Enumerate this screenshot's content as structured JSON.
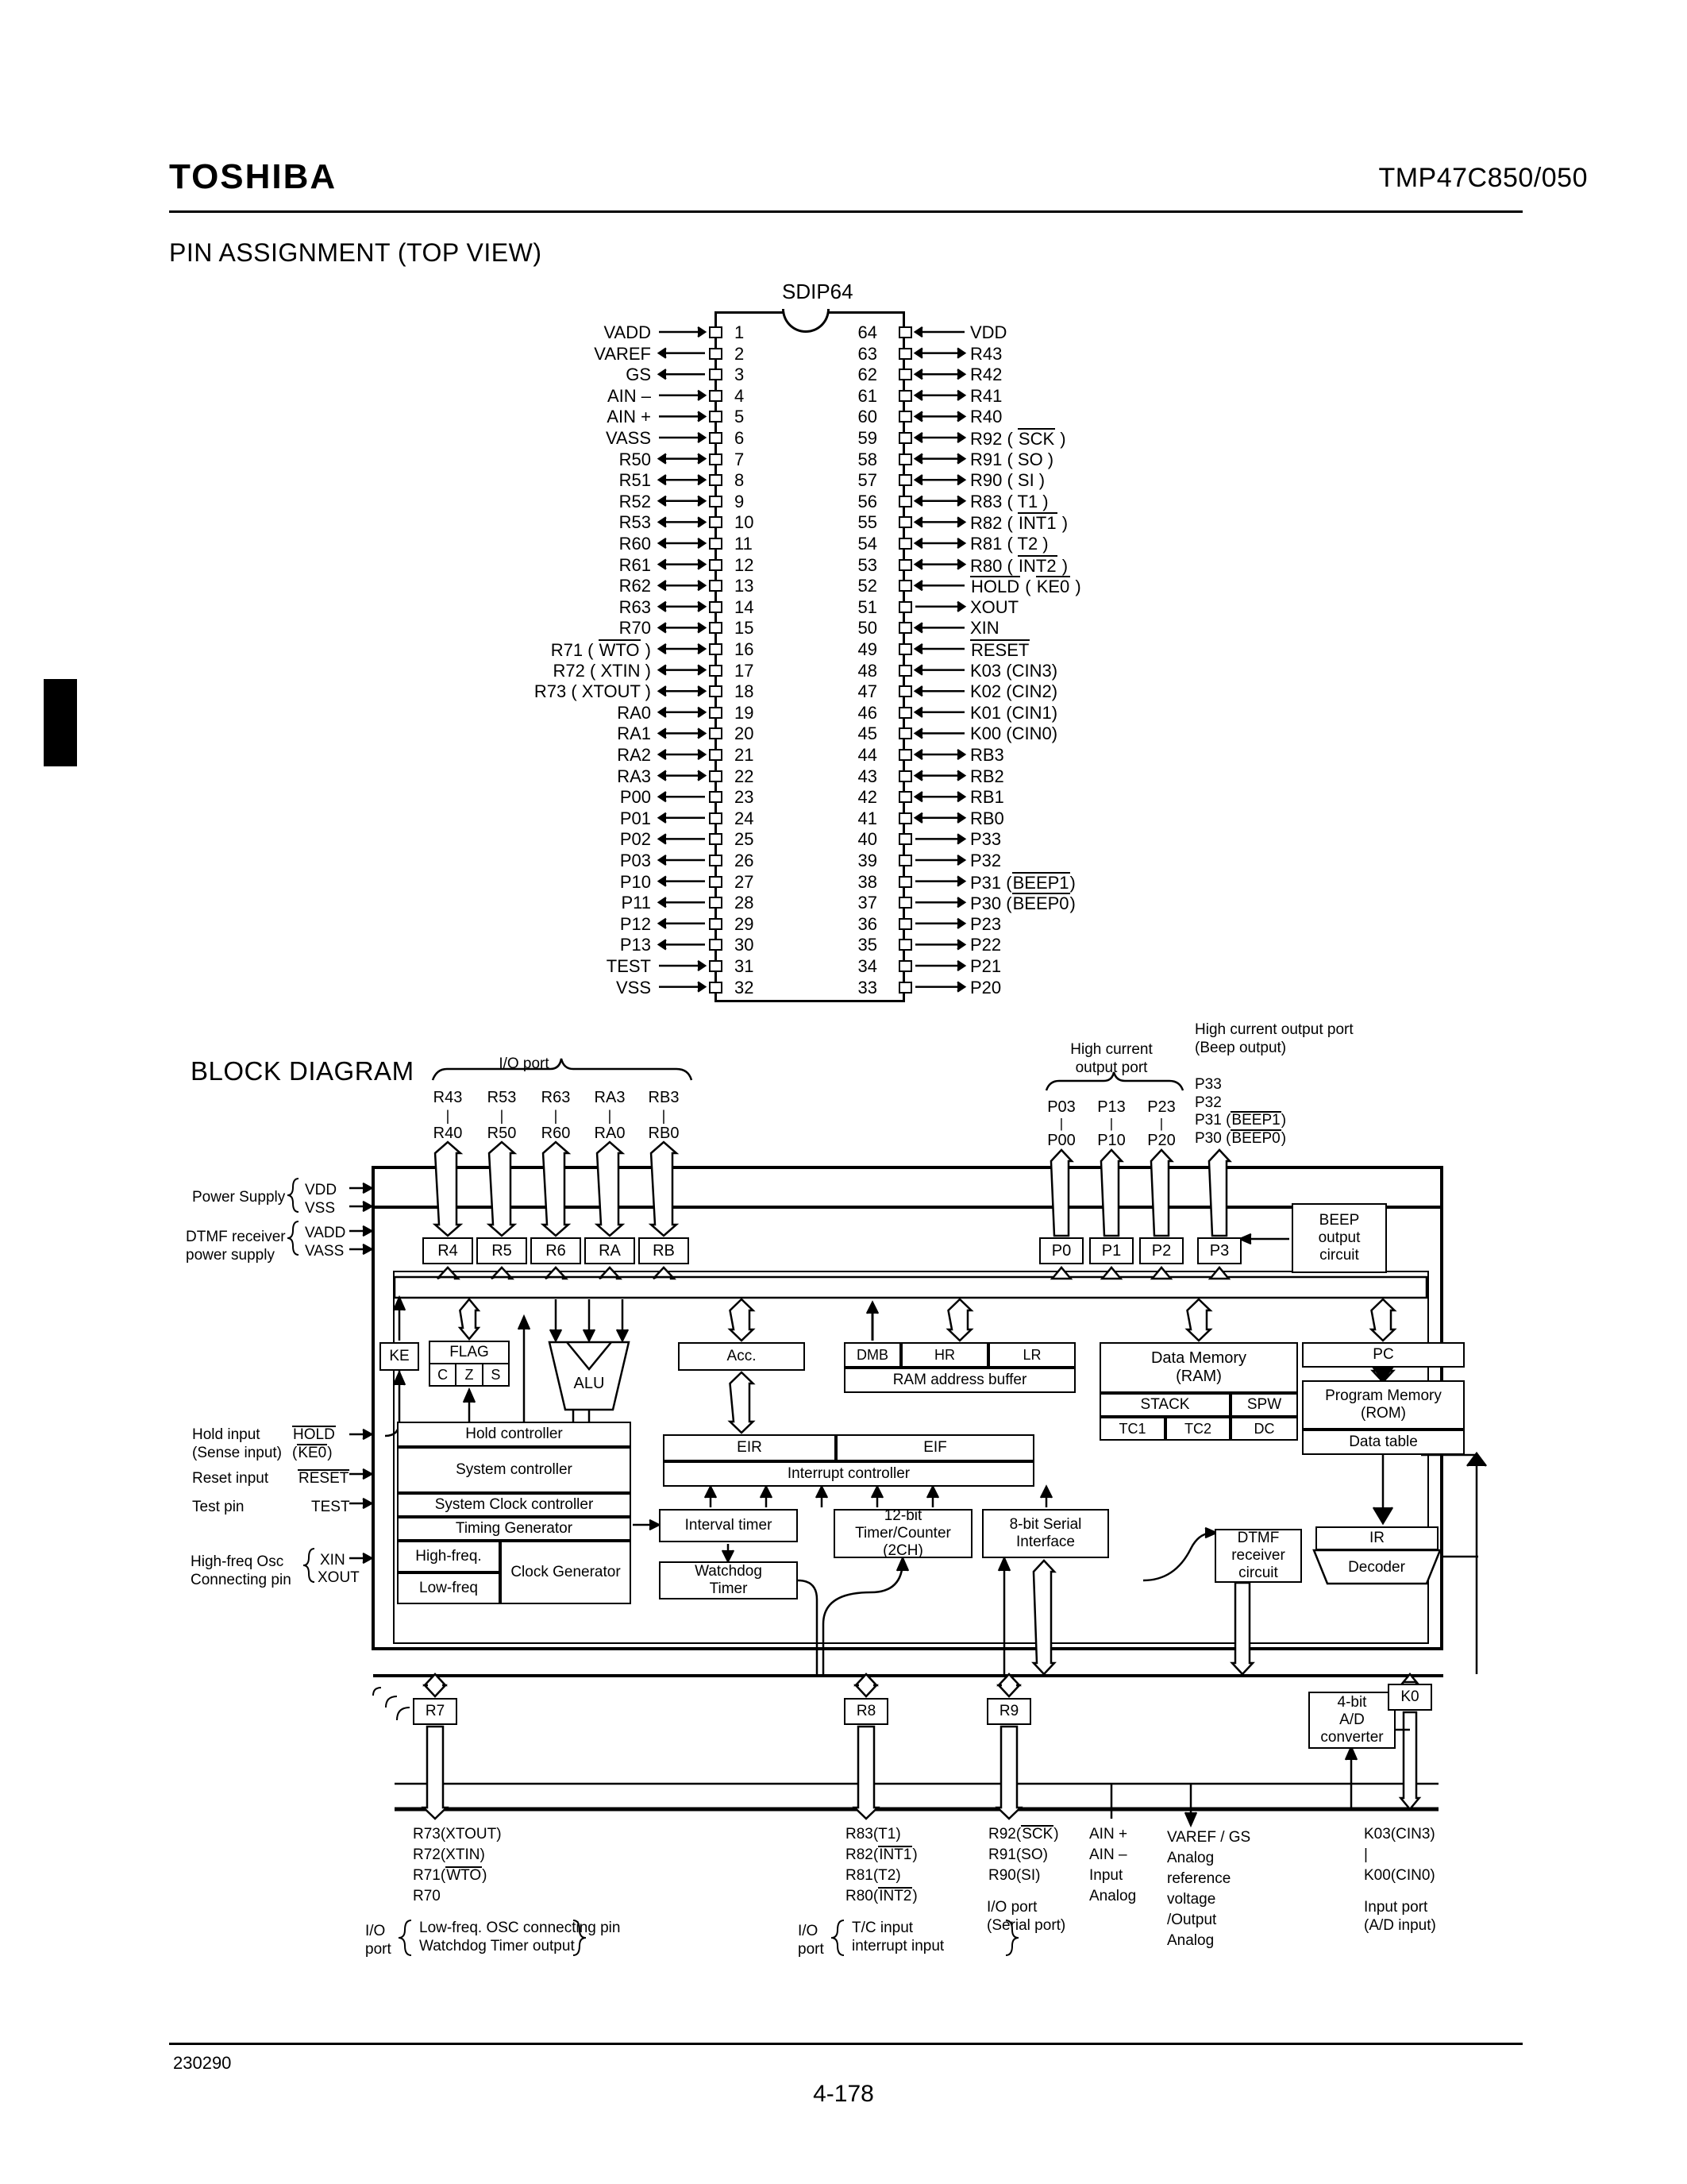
{
  "header": {
    "brand": "TOSHIBA",
    "part_number": "TMP47C850/050"
  },
  "pin_assignment": {
    "section_title": "PIN ASSIGNMENT (TOP VIEW)",
    "package": "SDIP64",
    "left_pins": [
      {
        "num": "1",
        "label": "VADD",
        "dir": "in"
      },
      {
        "num": "2",
        "label": "VAREF",
        "dir": "out"
      },
      {
        "num": "3",
        "label": "GS",
        "dir": "out"
      },
      {
        "num": "4",
        "label": "AIN –",
        "dir": "in"
      },
      {
        "num": "5",
        "label": "AIN +",
        "dir": "in"
      },
      {
        "num": "6",
        "label": "VASS",
        "dir": "in"
      },
      {
        "num": "7",
        "label": "R50",
        "dir": "io"
      },
      {
        "num": "8",
        "label": "R51",
        "dir": "io"
      },
      {
        "num": "9",
        "label": "R52",
        "dir": "io"
      },
      {
        "num": "10",
        "label": "R53",
        "dir": "io"
      },
      {
        "num": "11",
        "label": "R60",
        "dir": "io"
      },
      {
        "num": "12",
        "label": "R61",
        "dir": "io"
      },
      {
        "num": "13",
        "label": "R62",
        "dir": "io"
      },
      {
        "num": "14",
        "label": "R63",
        "dir": "io"
      },
      {
        "num": "15",
        "label": "R70",
        "dir": "io"
      },
      {
        "num": "16",
        "label": "R71 ( WTO )",
        "dir": "io",
        "overline": "WTO"
      },
      {
        "num": "17",
        "label": "R72 ( XTIN )",
        "dir": "io"
      },
      {
        "num": "18",
        "label": "R73 ( XTOUT )",
        "dir": "io"
      },
      {
        "num": "19",
        "label": "RA0",
        "dir": "io"
      },
      {
        "num": "20",
        "label": "RA1",
        "dir": "io"
      },
      {
        "num": "21",
        "label": "RA2",
        "dir": "io"
      },
      {
        "num": "22",
        "label": "RA3",
        "dir": "io"
      },
      {
        "num": "23",
        "label": "P00",
        "dir": "out"
      },
      {
        "num": "24",
        "label": "P01",
        "dir": "out"
      },
      {
        "num": "25",
        "label": "P02",
        "dir": "out"
      },
      {
        "num": "26",
        "label": "P03",
        "dir": "out"
      },
      {
        "num": "27",
        "label": "P10",
        "dir": "out"
      },
      {
        "num": "28",
        "label": "P11",
        "dir": "out"
      },
      {
        "num": "29",
        "label": "P12",
        "dir": "out"
      },
      {
        "num": "30",
        "label": "P13",
        "dir": "out"
      },
      {
        "num": "31",
        "label": "TEST",
        "dir": "in"
      },
      {
        "num": "32",
        "label": "VSS",
        "dir": "in"
      }
    ],
    "right_pins": [
      {
        "num": "64",
        "label": "VDD",
        "dir": "in"
      },
      {
        "num": "63",
        "label": "R43",
        "dir": "io"
      },
      {
        "num": "62",
        "label": "R42",
        "dir": "io"
      },
      {
        "num": "61",
        "label": "R41",
        "dir": "io"
      },
      {
        "num": "60",
        "label": "R40",
        "dir": "io"
      },
      {
        "num": "59",
        "label": "R92 ( SCK )",
        "dir": "io",
        "overline": "SCK"
      },
      {
        "num": "58",
        "label": "R91 ( SO )",
        "dir": "io"
      },
      {
        "num": "57",
        "label": "R90 ( SI )",
        "dir": "io"
      },
      {
        "num": "56",
        "label": "R83 ( T1 )",
        "dir": "io"
      },
      {
        "num": "55",
        "label": "R82 ( INT1 )",
        "dir": "io",
        "overline": "INT1"
      },
      {
        "num": "54",
        "label": "R81 ( T2 )",
        "dir": "io"
      },
      {
        "num": "53",
        "label": "R80 ( INT2 )",
        "dir": "io",
        "overline": "INT2"
      },
      {
        "num": "52",
        "label": "HOLD ( KE0 )",
        "dir": "in",
        "overline": "HOLD,KE0"
      },
      {
        "num": "51",
        "label": "XOUT",
        "dir": "out"
      },
      {
        "num": "50",
        "label": "XIN",
        "dir": "in"
      },
      {
        "num": "49",
        "label": "RESET",
        "dir": "in",
        "overline": "RESET"
      },
      {
        "num": "48",
        "label": "K03 (CIN3)",
        "dir": "in"
      },
      {
        "num": "47",
        "label": "K02 (CIN2)",
        "dir": "in"
      },
      {
        "num": "46",
        "label": "K01 (CIN1)",
        "dir": "in"
      },
      {
        "num": "45",
        "label": "K00 (CIN0)",
        "dir": "in"
      },
      {
        "num": "44",
        "label": "RB3",
        "dir": "io"
      },
      {
        "num": "43",
        "label": "RB2",
        "dir": "io"
      },
      {
        "num": "42",
        "label": "RB1",
        "dir": "io"
      },
      {
        "num": "41",
        "label": "RB0",
        "dir": "io"
      },
      {
        "num": "40",
        "label": "P33",
        "dir": "out"
      },
      {
        "num": "39",
        "label": "P32",
        "dir": "out"
      },
      {
        "num": "38",
        "label": "P31 (BEEP1)",
        "dir": "out",
        "overline": "BEEP1"
      },
      {
        "num": "37",
        "label": "P30 (BEEP0)",
        "dir": "out",
        "overline": "BEEP0"
      },
      {
        "num": "36",
        "label": "P23",
        "dir": "out"
      },
      {
        "num": "35",
        "label": "P22",
        "dir": "out"
      },
      {
        "num": "34",
        "label": "P21",
        "dir": "out"
      },
      {
        "num": "33",
        "label": "P20",
        "dir": "out"
      }
    ]
  },
  "block_diagram": {
    "section_title": "BLOCK DIAGRAM",
    "io_port_brace_label": "I/O port",
    "io_port_groups": [
      {
        "top": "R43",
        "bottom": "R40",
        "reg": "R4"
      },
      {
        "top": "R53",
        "bottom": "R50",
        "reg": "R5"
      },
      {
        "top": "R63",
        "bottom": "R60",
        "reg": "R6"
      },
      {
        "top": "RA3",
        "bottom": "RA0",
        "reg": "RA"
      },
      {
        "top": "RB3",
        "bottom": "RB0",
        "reg": "RB"
      }
    ],
    "high_current_brace_label": "High current\noutput port",
    "high_current_groups": [
      {
        "top": "P03",
        "bottom": "P00",
        "reg": "P0"
      },
      {
        "top": "P13",
        "bottom": "P10",
        "reg": "P1"
      },
      {
        "top": "P23",
        "bottom": "P20",
        "reg": "P2"
      }
    ],
    "beep_port": {
      "title": "High current output port\n(Beep output)",
      "lines": [
        "P33",
        "P32",
        "P31 (BEEP1)",
        "P30 (BEEP0)"
      ],
      "reg": "P3"
    },
    "left_labels": {
      "power_supply": "Power Supply",
      "power_supply_pins": [
        "VDD",
        "VSS"
      ],
      "dtmf_supply": "DTMF receiver\npower supply",
      "dtmf_supply_pins": [
        "VADD",
        "VASS"
      ],
      "hold_input": "Hold input\n(Sense input)",
      "hold_pin": "HOLD\n(KE0)",
      "reset_input": "Reset input",
      "reset_pin": "RESET",
      "test_pin_label": "Test pin",
      "test_pin": "TEST",
      "osc_label": "High-freq Osc\nConnecting pin",
      "osc_pins": [
        "XIN",
        "XOUT"
      ]
    },
    "blocks": {
      "ke": "KE",
      "flag": "FLAG",
      "flag_bits": [
        "C",
        "Z",
        "S"
      ],
      "alu": "ALU",
      "acc": "Acc.",
      "dmb": "DMB",
      "hr": "HR",
      "lr": "LR",
      "ram_address_buffer": "RAM address buffer",
      "data_memory": "Data Memory\n(RAM)",
      "stack": "STACK",
      "spw": "SPW",
      "tc1": "TC1",
      "tc2": "TC2",
      "dc": "DC",
      "pc": "PC",
      "program_memory": "Program Memory\n(ROM)",
      "data_table": "Data table",
      "ir": "IR",
      "decoder": "Decoder",
      "eir": "EIR",
      "eif": "EIF",
      "interrupt_controller": "Interrupt controller",
      "hold_controller": "Hold controller",
      "system_controller": "System controller",
      "system_clock_controller": "System Clock controller",
      "timing_generator": "Timing Generator",
      "high_freq": "High-freq.",
      "low_freq": "Low-freq",
      "clock_generator": "Clock Generator",
      "interval_timer": "Interval timer",
      "watchdog_timer": "Watchdog\nTimer",
      "timer_counter": "12-bit\nTimer/Counter\n(2CH)",
      "serial_interface": "8-bit Serial\nInterface",
      "dtmf_receiver": "DTMF\nreceiver\ncircuit",
      "beep_output": "BEEP\noutput\ncircuit",
      "ad_converter": "4-bit\nA/D\nconverter",
      "r7": "R7",
      "r8": "R8",
      "r9": "R9",
      "k0": "K0"
    },
    "bottom_labels": [
      {
        "pins": [
          "R73(XTOUT)",
          "R72(XTIN)",
          "R71(WTO)",
          "R70"
        ],
        "desc_left": "I/O\nport",
        "desc": "Low-freq. OSC connecting pin\nWatchdog Timer output",
        "braced": true
      },
      {
        "pins": [
          "R83(T1)",
          "R82(INT1)",
          "R81(T2)",
          "R80(INT2)"
        ],
        "desc_left": "I/O\nport",
        "desc": "T/C input\ninterrupt input",
        "braced": true
      },
      {
        "pins": [
          "R92(SCK)",
          "R91(SO)",
          "R90(SI)"
        ],
        "desc": "I/O port\n(Serial port)",
        "braced": false
      },
      {
        "pins": [
          "AIN +",
          "AIN –",
          "Input",
          "Analog"
        ],
        "desc": "",
        "braced": false
      },
      {
        "pins": [
          "VAREF / GS",
          "Analog",
          "reference",
          "voltage",
          "/Output",
          "Analog"
        ],
        "desc": "",
        "braced": false
      },
      {
        "pins": [
          "K03(CIN3)",
          "|",
          "K00(CIN0)"
        ],
        "desc": "Input port\n(A/D input)",
        "braced": false
      }
    ]
  },
  "footer": {
    "code": "230290",
    "page": "4-178"
  }
}
